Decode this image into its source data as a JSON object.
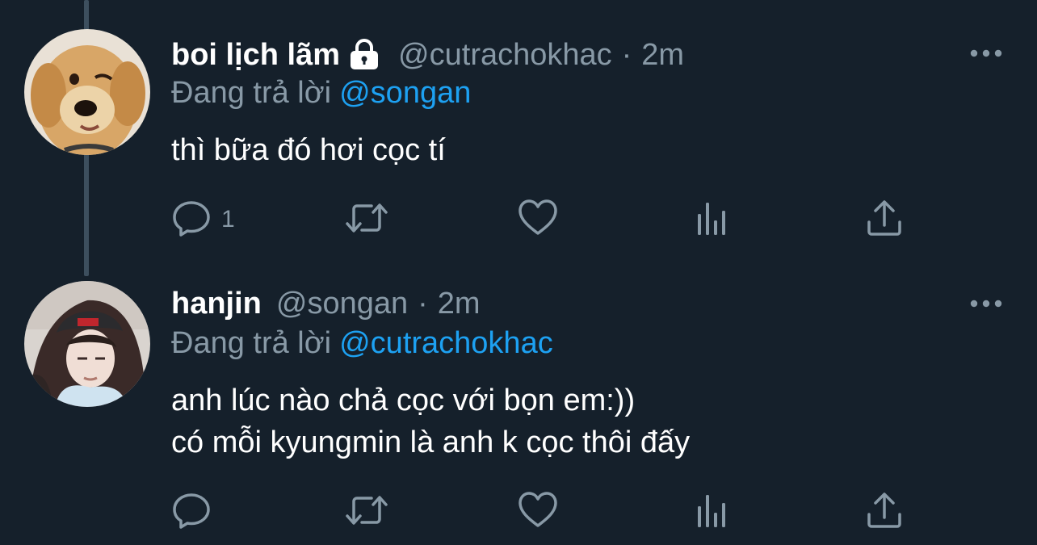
{
  "colors": {
    "background": "#15202b",
    "text_primary": "#ffffff",
    "text_secondary": "#8899a6",
    "accent": "#1da1f2",
    "thread_line": "#3d4f5e"
  },
  "tweets": [
    {
      "display_name": "boi lịch lãm",
      "protected": true,
      "protected_icon": "lock-icon",
      "handle": "@cutrachokhac",
      "separator": "·",
      "time": "2m",
      "replying_prefix": "Đang trả lời",
      "replying_to": "@songan",
      "text_lines": [
        "thì bữa đó hơi cọc tí"
      ],
      "avatar": "dog-avatar",
      "more_icon": "more-options-icon",
      "actions": {
        "reply_count": "1",
        "reply_icon": "reply-icon",
        "retweet_icon": "retweet-icon",
        "like_icon": "like-icon",
        "analytics_icon": "analytics-icon",
        "share_icon": "share-icon"
      }
    },
    {
      "display_name": "hanjin",
      "protected": false,
      "handle": "@songan",
      "separator": "·",
      "time": "2m",
      "replying_prefix": "Đang trả lời",
      "replying_to": "@cutrachokhac",
      "text_lines": [
        "anh lúc nào chả cọc với bọn em:))",
        "có mỗi kyungmin là anh k cọc thôi đấy"
      ],
      "avatar": "person-avatar",
      "more_icon": "more-options-icon",
      "actions": {
        "reply_count": "",
        "reply_icon": "reply-icon",
        "retweet_icon": "retweet-icon",
        "like_icon": "like-icon",
        "analytics_icon": "analytics-icon",
        "share_icon": "share-icon"
      }
    }
  ]
}
